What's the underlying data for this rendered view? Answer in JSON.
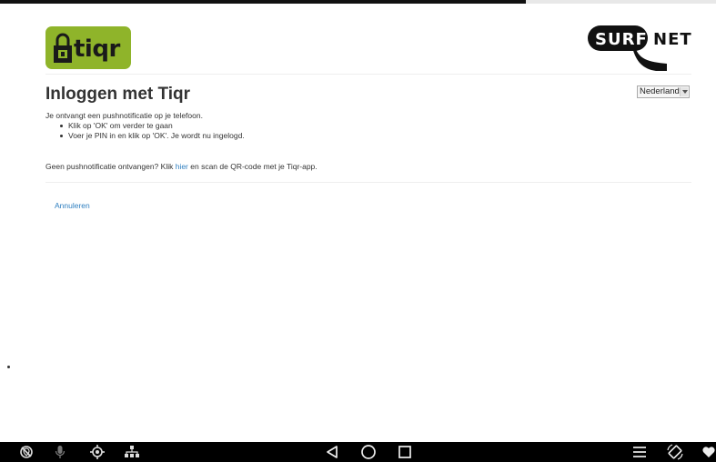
{
  "header": {
    "left_logo_text": "tiqr",
    "right_logo_badge_text": "SURF",
    "right_logo_suffix_text": "NET"
  },
  "language_select": {
    "selected": "Nederlands"
  },
  "title": "Inloggen met Tiqr",
  "instructions": {
    "intro": "Je ontvangt een pushnotificatie op je telefoon.",
    "steps": [
      "Klik op 'OK' om verder te gaan",
      "Voer je PIN in en klik op 'OK'. Je wordt nu ingelogd."
    ]
  },
  "no_push": {
    "prefix": "Geen pushnotificatie ontvangen? Klik ",
    "link": "hier",
    "suffix": " en scan de QR-code met je Tiqr-app."
  },
  "cancel_link": "Annuleren",
  "colors": {
    "tiqr_green": "#8fb42a",
    "link_blue": "#2f7fc0",
    "navbar_bg": "#000000"
  },
  "navbar": {
    "left_icons": [
      "no-location-icon",
      "microphone-icon",
      "gps-target-icon",
      "network-icon"
    ],
    "center_icons": [
      "back-icon",
      "home-icon",
      "recents-icon"
    ],
    "right_icons": [
      "menu-icon",
      "rotate-icon",
      "favorite-icon"
    ]
  }
}
